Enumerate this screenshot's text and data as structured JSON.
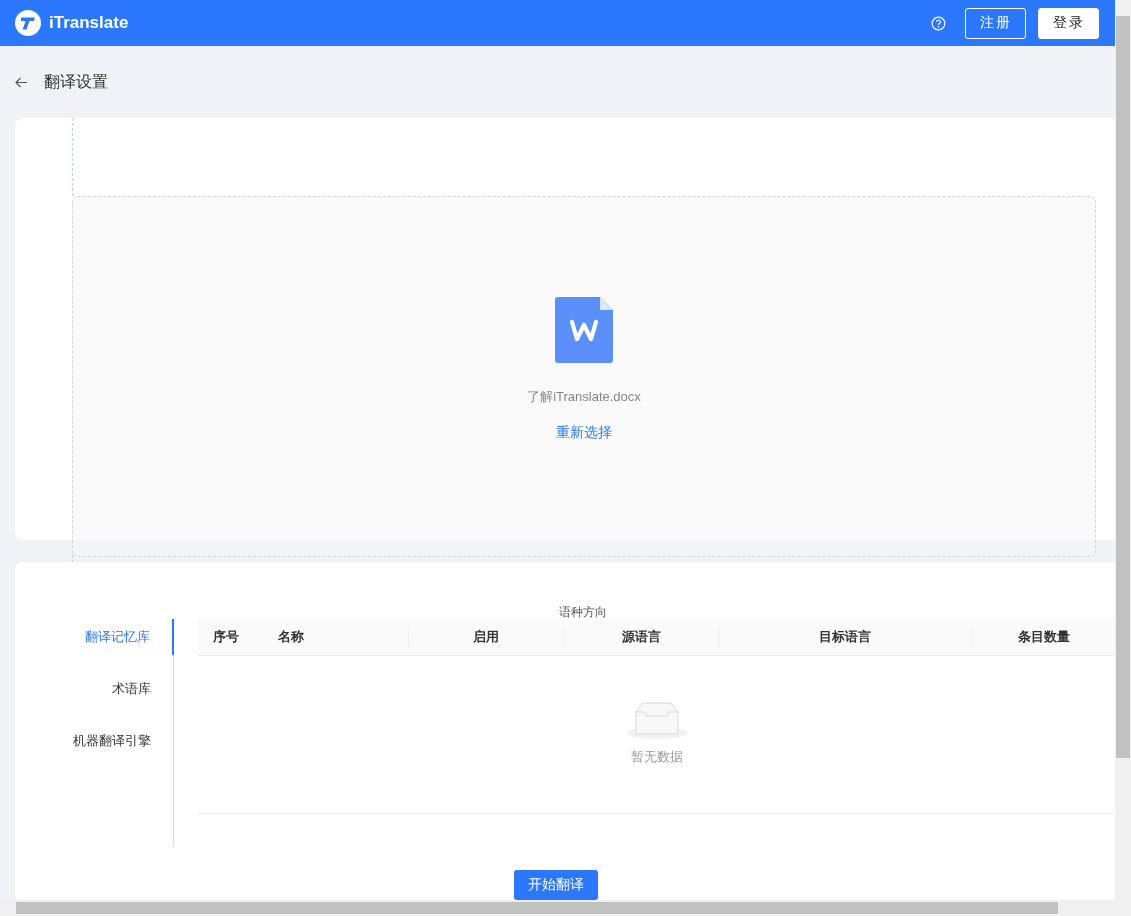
{
  "header": {
    "brand": "iTranslate",
    "buttons": [
      {
        "label": "注册",
        "kind": "outline"
      },
      {
        "label": "登录",
        "kind": "solid"
      }
    ]
  },
  "page_title": "翻译设置",
  "upload": {
    "file_name": "了解iTranslate.docx",
    "reselect_link": "重新选择"
  },
  "settings": {
    "tabs": [
      {
        "label": "翻译记忆库",
        "selected": true
      },
      {
        "label": "术语库",
        "selected": false
      },
      {
        "label": "机器翻译引擎",
        "selected": false
      }
    ],
    "direction_label": "语种方向",
    "table": {
      "columns": [
        "序号",
        "名称",
        "启用",
        "源语言",
        "目标语言",
        "条目数量"
      ],
      "empty_text": "暂无数据"
    }
  },
  "start_button": "开始翻译"
}
